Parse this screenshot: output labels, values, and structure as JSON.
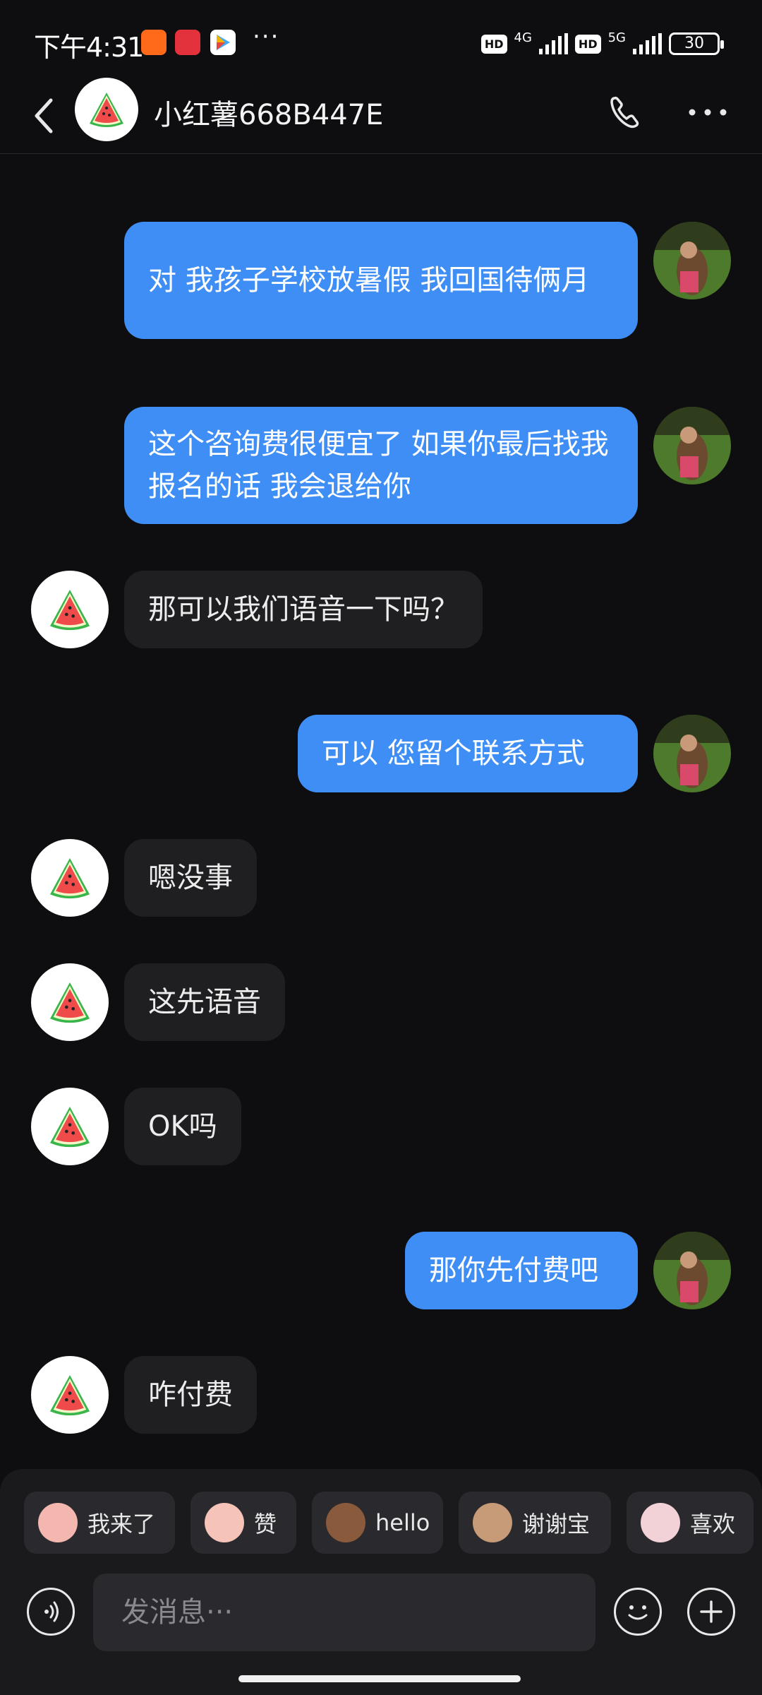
{
  "status_bar": {
    "time": "下午4:31",
    "more": "···",
    "hd1": "HD",
    "net1": "4G",
    "hd2": "HD",
    "net2": "5G",
    "battery": "30"
  },
  "header": {
    "title": "小红薯668B447E",
    "icons": [
      "back-icon",
      "watermelon-avatar",
      "phone-icon",
      "more-icon"
    ]
  },
  "messages": [
    {
      "side": "out",
      "text": "对 我孩子学校放暑假 我回国待俩月"
    },
    {
      "side": "out",
      "text": "这个咨询费很便宜了 如果你最后找我报名的话 我会退给你"
    },
    {
      "side": "in",
      "text": "那可以我们语音一下吗？"
    },
    {
      "side": "out",
      "text": "可以 您留个联系方式"
    },
    {
      "side": "in",
      "text": "嗯没事"
    },
    {
      "side": "in",
      "text": "这先语音"
    },
    {
      "side": "in",
      "text": "OK吗"
    },
    {
      "side": "out",
      "text": "那你先付费吧"
    },
    {
      "side": "in",
      "text": "咋付费"
    }
  ],
  "quick_replies": [
    {
      "label": "我来了",
      "color": "#f3b7b0"
    },
    {
      "label": "赞",
      "color": "#f6c3b8"
    },
    {
      "label": "hello",
      "color": "#8a5a3c"
    },
    {
      "label": "谢谢宝",
      "color": "#c79a78"
    },
    {
      "label": "喜欢",
      "color": "#f2d2d6"
    }
  ],
  "composer": {
    "placeholder": "发消息···"
  },
  "colors": {
    "background": "#0e0e10",
    "outgoing_bubble": "#3f8ef5",
    "incoming_bubble": "#1f1f22"
  }
}
